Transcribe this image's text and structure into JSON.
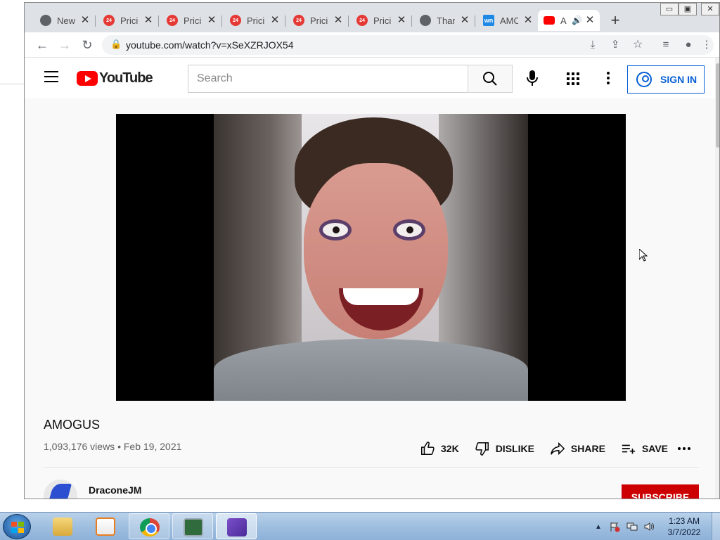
{
  "browser": {
    "tabs": [
      {
        "label": "New",
        "icon": "chrome-icon"
      },
      {
        "label": "Pricir",
        "icon": "red-24-icon"
      },
      {
        "label": "Pricir",
        "icon": "red-24-icon"
      },
      {
        "label": "Pricir",
        "icon": "red-24-icon"
      },
      {
        "label": "Pricir",
        "icon": "red-24-icon"
      },
      {
        "label": "Pricir",
        "icon": "red-24-icon"
      },
      {
        "label": "Than",
        "icon": "globe-icon"
      },
      {
        "label": "AMC",
        "icon": "wn-icon"
      },
      {
        "label": "A",
        "icon": "youtube-icon",
        "active": true
      }
    ],
    "favicon_badge": "24",
    "wn_badge": "wn",
    "url": "youtube.com/watch?v=xSeXZRJOX54",
    "window_controls": {
      "minimize": "▭",
      "restore": "▣",
      "close": "✕"
    }
  },
  "youtube": {
    "logo_text": "YouTube",
    "search_placeholder": "Search",
    "sign_in_label": "SIGN IN",
    "video": {
      "title": "AMOGUS",
      "views": "1,093,176 views",
      "date": "Feb 19, 2021",
      "likes": "32K",
      "dislike_label": "DISLIKE",
      "share_label": "SHARE",
      "save_label": "SAVE"
    },
    "channel": {
      "name": "DraconeJM"
    },
    "subscribe_label": "SUBSCRIBE"
  },
  "taskbar": {
    "time": "1:23 AM",
    "date": "3/7/2022",
    "tray_arrow": "▲"
  },
  "colors": {
    "yt_red": "#ff0000",
    "sign_in_blue": "#065fd4",
    "subscribe_red": "#cc0000"
  }
}
